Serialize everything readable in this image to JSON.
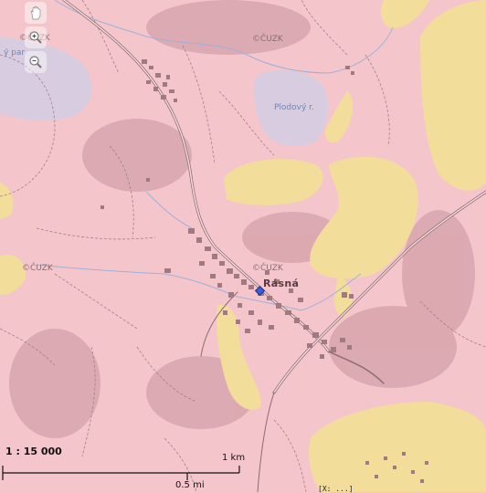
{
  "map": {
    "labels": {
      "cuzk_1": "©ČUZK",
      "cuzk_2": "©ČUZK",
      "cuzk_3": "©ČUZK",
      "cuzk_4": "©ČUZK",
      "pond": "Plodový r.",
      "pond_left": "ý par",
      "village": "Rásná"
    },
    "colors": {
      "background": "#f4c6cc",
      "water": "#d8cde0",
      "sand_area": "#f2dd9a",
      "road": "#8b6b70",
      "building": "#a07a80",
      "stream": "#9fb0d8",
      "marker": "#2a4fd0"
    }
  },
  "tools": {
    "pan_icon": "hand-icon",
    "zoom_in_icon": "zoom-in-icon",
    "zoom_out_icon": "zoom-out-icon"
  },
  "scale": {
    "ratio": "1 : 15 000",
    "km_label": "1 km",
    "mi_label": "0.5 mi"
  },
  "coords": "[X: ...]"
}
